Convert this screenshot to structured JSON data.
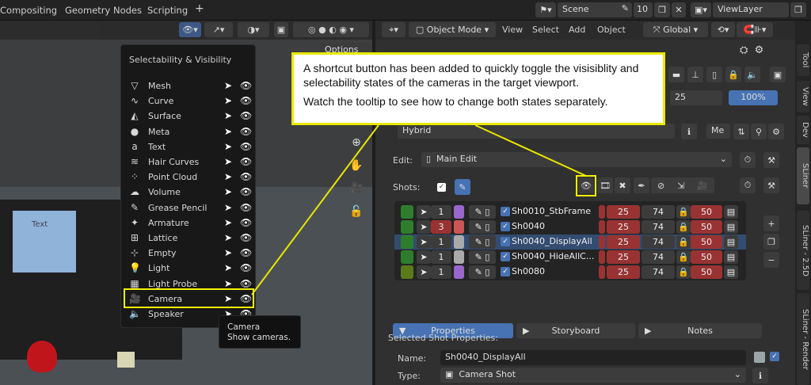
{
  "topbar": {
    "tabs": [
      "Compositing",
      "Geometry Nodes",
      "Scripting"
    ],
    "add_tab": "+",
    "scene_label": "Scene",
    "scene_count": "10",
    "viewlayer_label": "ViewLayer"
  },
  "viewport": {
    "options_label": "Options",
    "text_object_label": "Text"
  },
  "popup": {
    "title": "Selectability & Visibility",
    "items": [
      {
        "label": "Mesh",
        "icon": "mesh-icon"
      },
      {
        "label": "Curve",
        "icon": "curve-icon"
      },
      {
        "label": "Surface",
        "icon": "surface-icon"
      },
      {
        "label": "Meta",
        "icon": "meta-icon"
      },
      {
        "label": "Text",
        "icon": "text-icon"
      },
      {
        "label": "Hair Curves",
        "icon": "hair-curves-icon"
      },
      {
        "label": "Point Cloud",
        "icon": "point-cloud-icon"
      },
      {
        "label": "Volume",
        "icon": "volume-icon"
      },
      {
        "label": "Grease Pencil",
        "icon": "grease-pencil-icon"
      },
      {
        "label": "Armature",
        "icon": "armature-icon"
      },
      {
        "label": "Lattice",
        "icon": "lattice-icon"
      },
      {
        "label": "Empty",
        "icon": "empty-icon"
      },
      {
        "label": "Light",
        "icon": "light-icon"
      },
      {
        "label": "Light Probe",
        "icon": "light-probe-icon"
      },
      {
        "label": "Camera",
        "icon": "camera-icon"
      },
      {
        "label": "Speaker",
        "icon": "speaker-icon"
      }
    ]
  },
  "tooltip": {
    "title": "Camera",
    "description": "Show cameras."
  },
  "annotation": {
    "line1": "A shortcut button has been added to quickly toggle the visisiblity and selectability states of the cameras in the target viewport.",
    "line2": "Watch the tooltip to see how to change both states separately."
  },
  "rheader": {
    "mode": "Object Mode",
    "menus": [
      "View",
      "Select",
      "Add",
      "Object"
    ],
    "transform": "Global"
  },
  "stampinfo": {
    "left_value": "25",
    "percent": "100%"
  },
  "hybrid_label": "Hybrid",
  "me_label": "Me",
  "edit": {
    "label": "Edit:",
    "value": "Main Edit"
  },
  "shots": {
    "label": "Shots:",
    "rows": [
      {
        "take": "1",
        "name": "Sh0010_StbFrame",
        "start": "25",
        "dur": "74",
        "end": "50",
        "color": "#2e7d2e",
        "swatch": "#9966cc",
        "selected": false
      },
      {
        "take": "3",
        "name": "Sh0040",
        "start": "25",
        "dur": "74",
        "end": "50",
        "color": "#2e7d2e",
        "swatch": "#cc5555",
        "selected": false
      },
      {
        "take": "1",
        "name": "Sh0040_DisplayAll",
        "start": "25",
        "dur": "74",
        "end": "50",
        "color": "#2e7d2e",
        "swatch": "#aaaaaa",
        "selected": true
      },
      {
        "take": "1",
        "name": "Sh0040_HideAllC...",
        "start": "25",
        "dur": "74",
        "end": "50",
        "color": "#2e7d2e",
        "swatch": "#aaaaaa",
        "selected": false
      },
      {
        "take": "1",
        "name": "Sh0080",
        "start": "25",
        "dur": "74",
        "end": "50",
        "color": "#5a7a1a",
        "swatch": "#9966cc",
        "selected": false
      }
    ]
  },
  "tabs": {
    "properties": "Properties",
    "storyboard": "Storyboard",
    "notes": "Notes"
  },
  "selected_shot": {
    "section": "Selected Shot Properties:",
    "name_label": "Name:",
    "name_value": "Sh0040_DisplayAll",
    "type_label": "Type:",
    "type_value": "Camera Shot"
  },
  "sidetabs": [
    "Tool",
    "View",
    "Dev",
    "SLiner",
    "SLiner - 2.5D",
    "SLiner - Render"
  ]
}
